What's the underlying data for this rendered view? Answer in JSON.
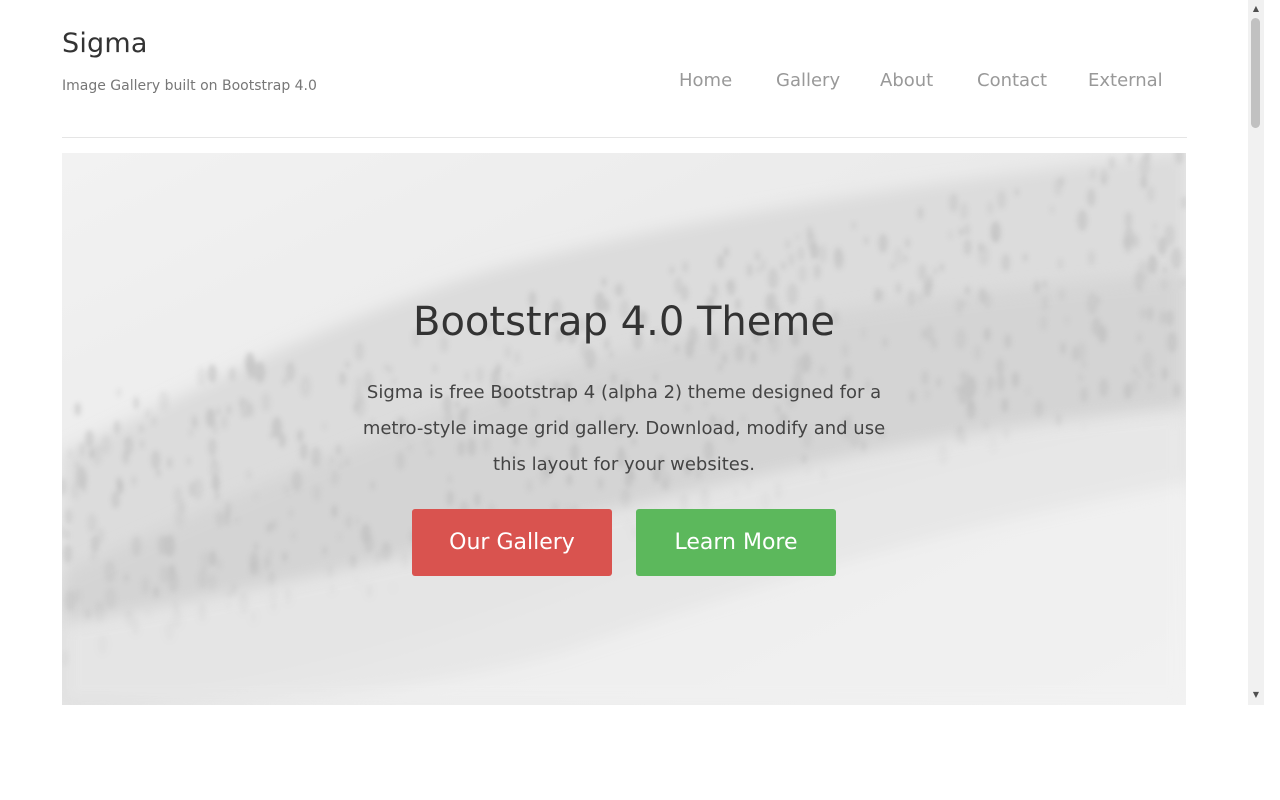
{
  "site": {
    "title": "Sigma",
    "tagline": "Image Gallery built on Bootstrap 4.0"
  },
  "nav": {
    "items": [
      "Home",
      "Gallery",
      "About",
      "Contact",
      "External"
    ]
  },
  "hero": {
    "title": "Bootstrap 4.0 Theme",
    "text": "Sigma is free Bootstrap 4 (alpha 2) theme designed for a metro-style image grid gallery. Download, modify and use this layout for your websites.",
    "buttons": {
      "gallery": "Our Gallery",
      "more": "Learn More"
    },
    "background": "snowy-forested-hillside-image"
  },
  "colors": {
    "gallery_button": "#d9534f",
    "more_button": "#5cb85c",
    "nav_text": "#999999"
  },
  "icons": {
    "scroll_up": "▲",
    "scroll_down": "▼"
  }
}
